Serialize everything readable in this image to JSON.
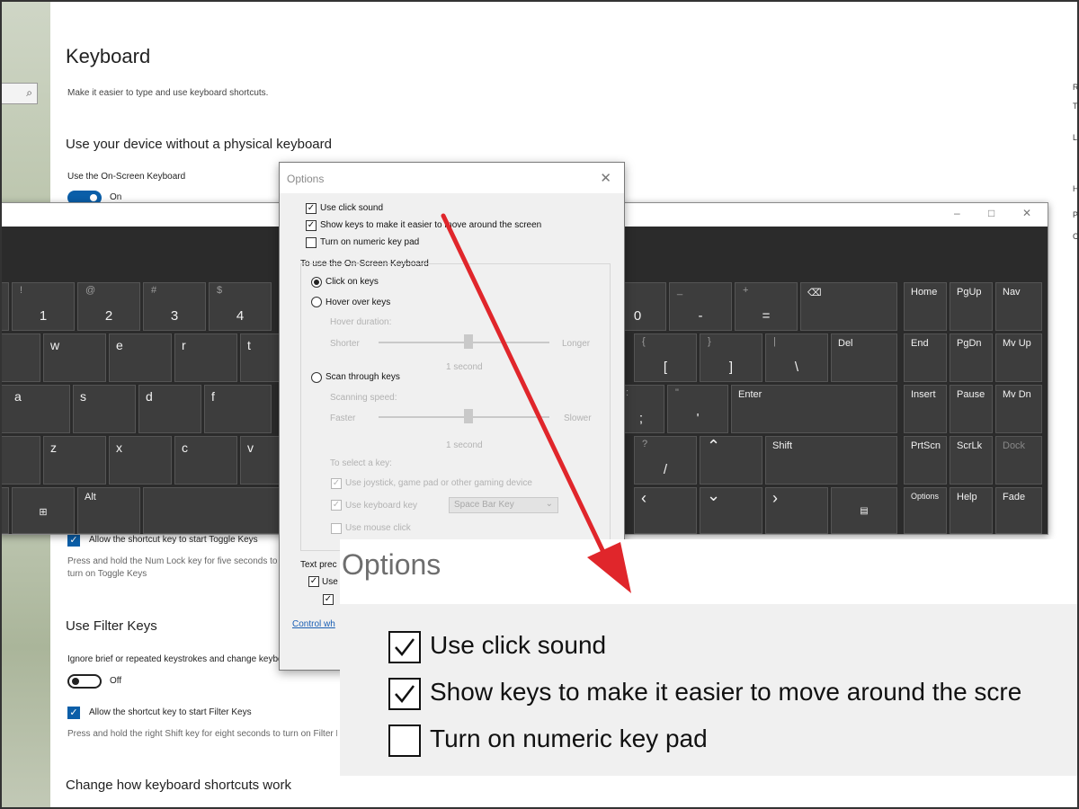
{
  "settings": {
    "title": "Keyboard",
    "subtitle": "Make it easier to type and use keyboard shortcuts.",
    "osk_section": "Use your device without a physical keyboard",
    "osk_label": "Use the On-Screen Keyboard",
    "osk_toggle_state": "On",
    "toggle_shortcut_cb": "Allow the shortcut key to start Toggle Keys",
    "toggle_desc": "Press and hold the Num Lock key for five seconds to turn on Toggle Keys",
    "filter_section": "Use Filter Keys",
    "filter_label": "Ignore brief or repeated keystrokes and change keyboard repeat rates",
    "filter_toggle_state": "Off",
    "filter_shortcut_cb": "Allow the shortcut key to start Filter Keys",
    "filter_desc": "Press and hold the right Shift key for eight seconds to turn on Filter Keys",
    "shortcuts_section": "Change how keyboard shortcuts work"
  },
  "osk": {
    "row1": [
      {
        "s": "!",
        "m": "1"
      },
      {
        "s": "@",
        "m": "2"
      },
      {
        "s": "#",
        "m": "3"
      },
      {
        "s": "$",
        "m": "4"
      },
      {
        "s": "",
        "m": "0"
      },
      {
        "s": "_",
        "m": "-"
      },
      {
        "s": "+",
        "m": "="
      }
    ],
    "row2": [
      "w",
      "e",
      "r",
      "t"
    ],
    "row2_right": [
      {
        "s": "{",
        "m": "["
      },
      {
        "s": "}",
        "m": "]"
      },
      {
        "s": "|",
        "m": "\\"
      }
    ],
    "row3": [
      "a",
      "s",
      "d",
      "f"
    ],
    "row3_right": [
      {
        "s": ":",
        "m": ";"
      },
      {
        "s": "\"",
        "m": "'"
      }
    ],
    "row4": [
      "z",
      "x",
      "c",
      "v"
    ],
    "row4_right": [
      {
        "s": "?",
        "m": "/"
      }
    ],
    "keys": {
      "del": "Del",
      "enter": "Enter",
      "shift": "Shift",
      "alt": "Alt",
      "home": "Home",
      "pgup": "PgUp",
      "nav": "Nav",
      "end": "End",
      "pgdn": "PgDn",
      "mvup": "Mv Up",
      "insert": "Insert",
      "pause": "Pause",
      "mvdn": "Mv Dn",
      "prtscn": "PrtScn",
      "scrlk": "ScrLk",
      "dock": "Dock",
      "options": "Options",
      "help": "Help",
      "fade": "Fade"
    },
    "title_controls": [
      "–",
      "□",
      "✕"
    ]
  },
  "options_dialog": {
    "title": "Options",
    "cb1": "Use click sound",
    "cb2": "Show keys to make it easier to move around the screen",
    "cb3": "Turn on numeric key pad",
    "group_label": "To use the On-Screen Keyboard",
    "radio1": "Click on keys",
    "radio2": "Hover over keys",
    "hover_duration": "Hover duration:",
    "shorter": "Shorter",
    "longer": "Longer",
    "hover_value": "1 second",
    "radio3": "Scan through keys",
    "scan_speed": "Scanning speed:",
    "faster": "Faster",
    "slower": "Slower",
    "scan_value": "1 second",
    "select_key": "To select a key:",
    "sel1": "Use joystick, game pad or other gaming device",
    "sel2": "Use keyboard key",
    "dropdown": "Space Bar Key",
    "sel3": "Use mouse click",
    "text_pred": "Text prec",
    "text_cb1": "Use",
    "link": "Control wh"
  },
  "zoom": {
    "title": "Options",
    "cb1": "Use click sound",
    "cb2": "Show keys to make it easier to move around the scre",
    "cb3": "Turn on numeric key pad"
  },
  "right_edge": [
    "R",
    "T",
    "L",
    "H",
    "P",
    "C"
  ],
  "colors": {
    "accent": "#0a5ea8",
    "arrow": "#e0262b",
    "osk_bg": "#2b2b2b",
    "key": "#3d3d3d"
  }
}
